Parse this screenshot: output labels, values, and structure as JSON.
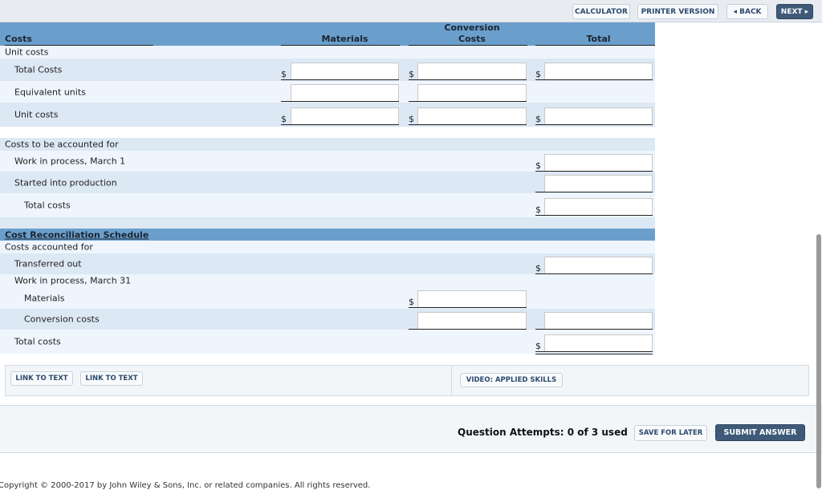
{
  "toolbar": {
    "calculator": "CALCULATOR",
    "printer_version": "PRINTER VERSION",
    "back": "◂ BACK",
    "next": "NEXT ▸"
  },
  "table_header": {
    "costs": "Costs",
    "materials": "Materials",
    "conversion_line1": "Conversion",
    "conversion_line2": "Costs",
    "total": "Total"
  },
  "currency_symbol": "$",
  "rows": [
    {
      "label": "Unit costs",
      "indent": 0,
      "fields": []
    },
    {
      "label": "Total Costs",
      "indent": 1,
      "fields": [
        "materials",
        "conversion",
        "total"
      ],
      "dollar": true,
      "double": true
    },
    {
      "label": "Equivalent units",
      "indent": 1,
      "fields": [
        "materials",
        "conversion"
      ],
      "dollar": false
    },
    {
      "label": "Unit costs",
      "indent": 1,
      "fields": [
        "materials",
        "conversion",
        "total"
      ],
      "dollar": true,
      "double": true
    },
    {
      "label": "",
      "indent": 0,
      "fields": []
    },
    {
      "label": "Costs to be accounted for",
      "indent": 0,
      "fields": []
    },
    {
      "label": "Work in process, March 1",
      "indent": 1,
      "fields": [
        "total"
      ],
      "dollar": true
    },
    {
      "label": "Started into production",
      "indent": 1,
      "fields": [
        "total"
      ],
      "dollar": false
    },
    {
      "label": "Total costs",
      "indent": 2,
      "fields": [
        "total"
      ],
      "dollar": true,
      "double": true
    },
    {
      "label": "",
      "indent": 0,
      "fields": []
    },
    {
      "label": "Cost Reconciliation Schedule",
      "indent": 0,
      "fields": [],
      "header": true
    },
    {
      "label": "Costs accounted for",
      "indent": 0,
      "fields": []
    },
    {
      "label": "Transferred out",
      "indent": 1,
      "fields": [
        "total"
      ],
      "dollar": true
    },
    {
      "label": "Work in process, March 31",
      "indent": 1,
      "fields": []
    },
    {
      "label": "Materials",
      "indent": 2,
      "fields": [
        "conversion"
      ],
      "dollar": true
    },
    {
      "label": "Conversion costs",
      "indent": 2,
      "fields": [
        "conversion",
        "total"
      ],
      "dollar": false
    },
    {
      "label": "Total costs",
      "indent": 1,
      "fields": [
        "total"
      ],
      "dollar": true,
      "double": true
    }
  ],
  "links": {
    "link1": "LINK TO TEXT",
    "link2": "LINK TO TEXT",
    "video": "VIDEO: APPLIED SKILLS"
  },
  "footer": {
    "attempts": "Question Attempts: 0 of 3 used",
    "save": "SAVE FOR LATER",
    "submit": "SUBMIT ANSWER"
  },
  "copyright": "Copyright © 2000-2017 by John Wiley & Sons, Inc. or related companies. All rights reserved.",
  "colors": {
    "header_band": "#6a9fcc",
    "row_light": "#eef5fd",
    "row_dark": "#dde8f5",
    "primary_button": "#3e5a78"
  }
}
